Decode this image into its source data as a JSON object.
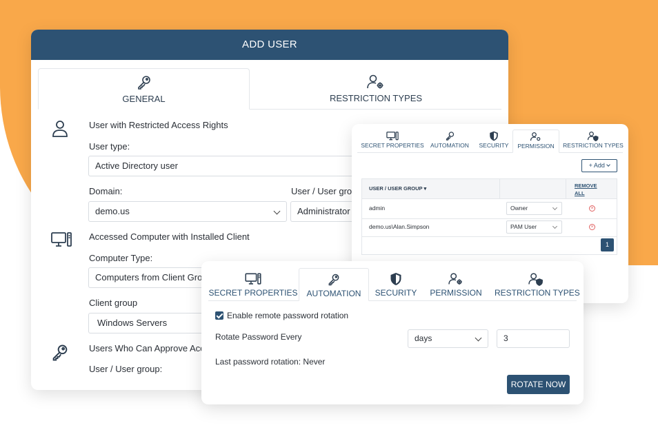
{
  "add_user": {
    "title": "ADD USER",
    "tabs": [
      {
        "label": "GENERAL",
        "icon": "key-icon"
      },
      {
        "label": "RESTRICTION TYPES",
        "icon": "user-gear-icon"
      }
    ],
    "section_restricted": "User with Restricted Access Rights",
    "user_type_label": "User type:",
    "user_type_value": "Active Directory user",
    "domain_label": "Domain:",
    "domain_value": "demo.us",
    "user_group_label": "User / User group",
    "user_group_value": "Administrator",
    "section_computer": "Accessed Computer with Installed Client",
    "computer_type_label": "Computer Type:",
    "computer_type_value": "Computers from Client Gro",
    "client_group_label": "Client group",
    "client_group_value": "Windows Servers",
    "section_approve": "Users Who Can Approve Acce",
    "approve_group_label": "User / User group:"
  },
  "permission": {
    "tabs": [
      {
        "label": "SECRET PROPERTIES",
        "icon": "computer-icon"
      },
      {
        "label": "AUTOMATION",
        "icon": "key-icon"
      },
      {
        "label": "SECURITY",
        "icon": "shield-icon"
      },
      {
        "label": "PERMISSION",
        "icon": "user-gear-icon"
      },
      {
        "label": "RESTRICTION TYPES",
        "icon": "user-shield-icon"
      }
    ],
    "add_label": "+ Add",
    "col_user": "USER / USER GROUP ▾",
    "col_remove_1": "REMOVE",
    "col_remove_2": "ALL",
    "rows": [
      {
        "user": "admin",
        "role": "Owner"
      },
      {
        "user": "demo.us\\Alan.Simpson",
        "role": "PAM User"
      }
    ],
    "page": "1"
  },
  "automation": {
    "tabs": [
      {
        "label": "SECRET PROPERTIES",
        "icon": "computer-icon"
      },
      {
        "label": "AUTOMATION",
        "icon": "key-icon"
      },
      {
        "label": "SECURITY",
        "icon": "shield-icon"
      },
      {
        "label": "PERMISSION",
        "icon": "user-gear-icon"
      },
      {
        "label": "RESTRICTION TYPES",
        "icon": "user-shield-icon"
      }
    ],
    "enable_label": "Enable remote password rotation",
    "rotate_label": "Rotate Password Every",
    "unit_value": "days",
    "count_value": "3",
    "last_rotation": "Last password rotation: Never",
    "rotate_btn": "ROTATE NOW"
  },
  "colors": {
    "accent": "#2d5273",
    "orange": "#f9a84a"
  }
}
